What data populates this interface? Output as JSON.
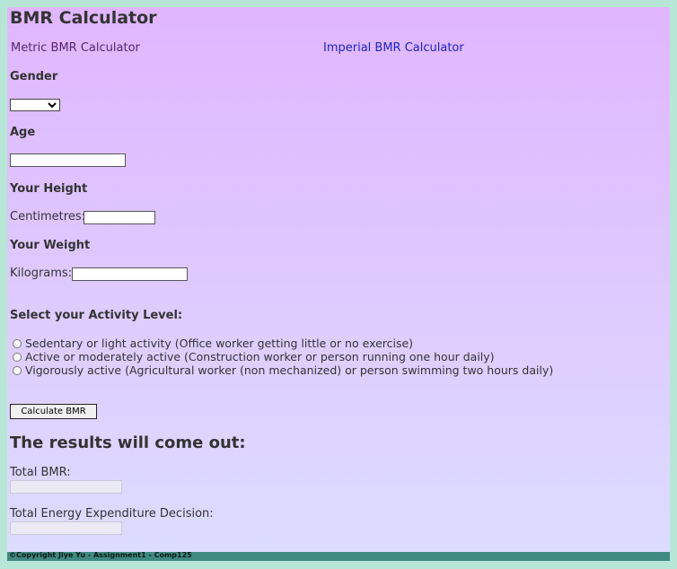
{
  "page": {
    "title": "BMR Calculator"
  },
  "nav": {
    "metric_label": "Metric BMR Calculator",
    "imperial_label": "Imperial BMR Calculator"
  },
  "form": {
    "gender_label": "Gender",
    "gender_value": "",
    "age_label": "Age",
    "age_value": "",
    "height_label": "Your Height",
    "height_unit_label": "Centimetres:",
    "height_value": "",
    "weight_label": "Your Weight",
    "weight_unit_label": "Kilograms:",
    "weight_value": "",
    "activity_label": "Select your Activity Level:",
    "activity_options": [
      "Sedentary or light activity (Office worker getting little or no exercise)",
      "Active or moderately active (Construction worker or person running one hour daily)",
      "Vigorously active (Agricultural worker (non mechanized) or person swimming two hours daily)"
    ],
    "calculate_label": "Calculate BMR"
  },
  "results": {
    "heading": "The results will come out:",
    "total_bmr_label": "Total BMR:",
    "total_bmr_value": "",
    "energy_label": "Total Energy Expenditure Decision:",
    "energy_value": ""
  },
  "footer": {
    "text": "©Copyright Jiye Yu - Assignment1 - Comp125"
  },
  "colors": {
    "background": "#b8e6d6",
    "gradient_top": "#e0b6ff",
    "gradient_bottom": "#dcdcff",
    "footer_bar": "#3f8a80",
    "visited_link": "#56256e",
    "link": "#1e24c8"
  }
}
